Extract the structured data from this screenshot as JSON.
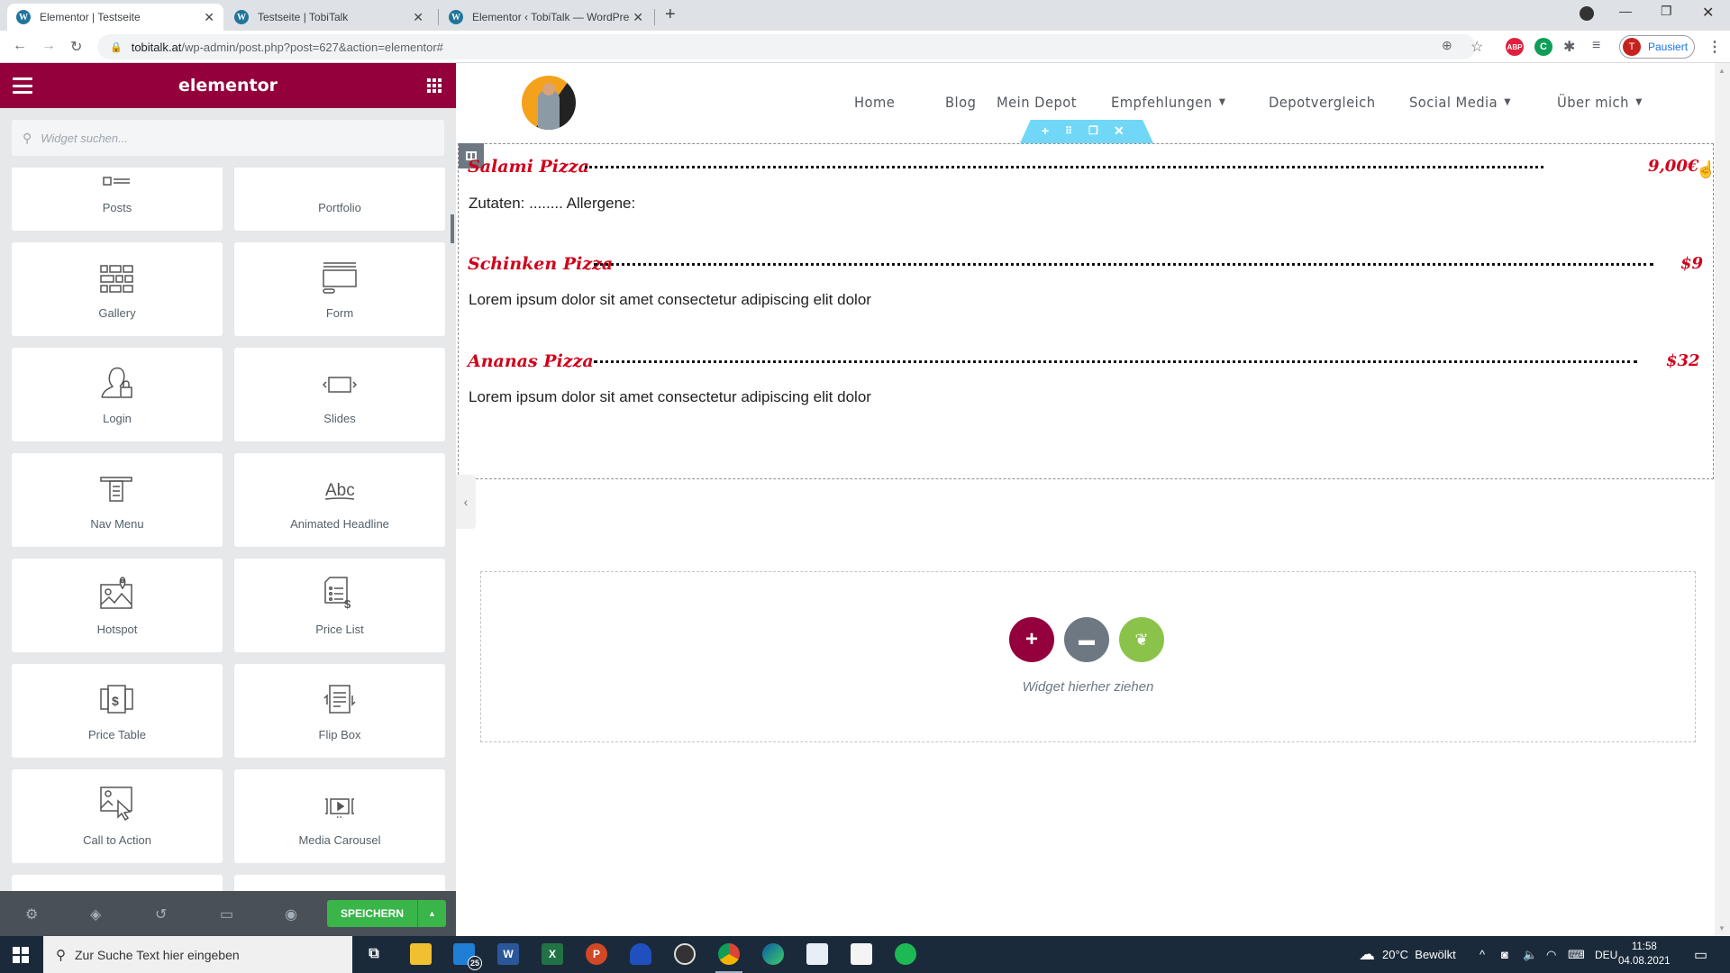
{
  "browser": {
    "tabs": [
      {
        "title": "Elementor | Testseite",
        "active": true
      },
      {
        "title": "Testseite | TobiTalk",
        "active": false
      },
      {
        "title": "Elementor ‹ TobiTalk — WordPres",
        "active": false
      }
    ],
    "url_host": "tobitalk.at",
    "url_path": "/wp-admin/post.php?post=627&action=elementor#",
    "profile_initial": "T",
    "profile_status": "Pausiert",
    "extensions": [
      "ABP",
      "C"
    ]
  },
  "panel": {
    "logo": "elementor",
    "search_placeholder": "Widget suchen...",
    "widgets": [
      {
        "label": "Posts",
        "icon": "posts-icon"
      },
      {
        "label": "Portfolio",
        "icon": "portfolio-icon"
      },
      {
        "label": "Gallery",
        "icon": "gallery-icon"
      },
      {
        "label": "Form",
        "icon": "form-icon"
      },
      {
        "label": "Login",
        "icon": "login-icon"
      },
      {
        "label": "Slides",
        "icon": "slides-icon"
      },
      {
        "label": "Nav Menu",
        "icon": "nav-menu-icon"
      },
      {
        "label": "Animated Headline",
        "icon": "animated-headline-icon"
      },
      {
        "label": "Hotspot",
        "icon": "hotspot-icon"
      },
      {
        "label": "Price List",
        "icon": "price-list-icon"
      },
      {
        "label": "Price Table",
        "icon": "price-table-icon"
      },
      {
        "label": "Flip Box",
        "icon": "flip-box-icon"
      },
      {
        "label": "Call to Action",
        "icon": "call-to-action-icon"
      },
      {
        "label": "Media Carousel",
        "icon": "media-carousel-icon"
      }
    ],
    "save_label": "SPEICHERN",
    "accent_color": "#93003c",
    "save_color": "#39b54a"
  },
  "site": {
    "nav": [
      {
        "label": "Home",
        "dropdown": false
      },
      {
        "label": "Blog",
        "dropdown": false
      },
      {
        "label": "Mein Depot",
        "dropdown": false
      },
      {
        "label": "Empfehlungen",
        "dropdown": true
      },
      {
        "label": "Depotvergleich",
        "dropdown": false
      },
      {
        "label": "Social Media",
        "dropdown": true
      },
      {
        "label": "Über mich",
        "dropdown": true
      }
    ],
    "price_list": [
      {
        "title": "Salami Pizza",
        "price": "9,00€",
        "description": "Zutaten: ........ Allergene:"
      },
      {
        "title": "Schinken Pizza",
        "price": "$9",
        "description": "Lorem ipsum dolor sit amet consectetur adipiscing elit dolor"
      },
      {
        "title": "Ananas Pizza",
        "price": "$32",
        "description": "Lorem ipsum dolor sit amet consectetur adipiscing elit dolor"
      }
    ],
    "dropzone_text": "Widget hierher ziehen"
  },
  "taskbar": {
    "search_placeholder": "Zur Suche Text hier eingeben",
    "mail_badge": "25",
    "weather": "20°C  Bewölkt",
    "language": "DEU",
    "time": "11:58",
    "date": "04.08.2021"
  }
}
